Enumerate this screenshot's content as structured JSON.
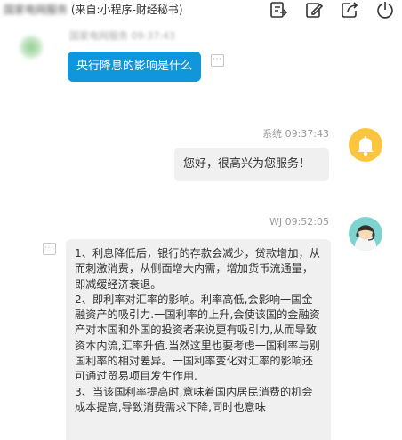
{
  "header": {
    "title_blurred": "国家电网服务",
    "title_source": " (来自:小程序-财经秘书)",
    "icons": [
      "export-icon",
      "edit-icon",
      "share-icon",
      "power-icon"
    ]
  },
  "messages": {
    "user": {
      "name_time_blurred": "国家电网服务 09:37:43",
      "text": "央行降息的影响是什么",
      "more": "···"
    },
    "system": {
      "name_time": "系统 09:37:43",
      "text": "您好，很高兴为您服务！"
    },
    "agent": {
      "name_time": "WJ 09:52:05",
      "more": "···",
      "paragraphs": [
        "1、利息降低后，银行的存款会减少，贷款增加，从而刺激消费，从侧面增大内需，增加货币流通量，即减缓经济衰退。",
        "2、即利率对汇率的影响。利率高低,会影响一国金融资产的吸引力.一国利率的上升,会使该国的金融资产对本国和外国的投资者来说更有吸引力,从而导致资本内流,汇率升值.当然这里也要考虑一国利率与别国利率的相对差异。一国利率变化对汇率的影响还可通过贸易项目发生作用.",
        "3、当该国利率提高时,意味着国内居民消费的机会成本提高,导致消费需求下降,同时也意味"
      ]
    }
  },
  "colors": {
    "user_bubble": "#1296db",
    "gray_bubble": "#f0f0f0",
    "bell_avatar": "#fbc63d",
    "cs_avatar": "#7fd3cf"
  }
}
